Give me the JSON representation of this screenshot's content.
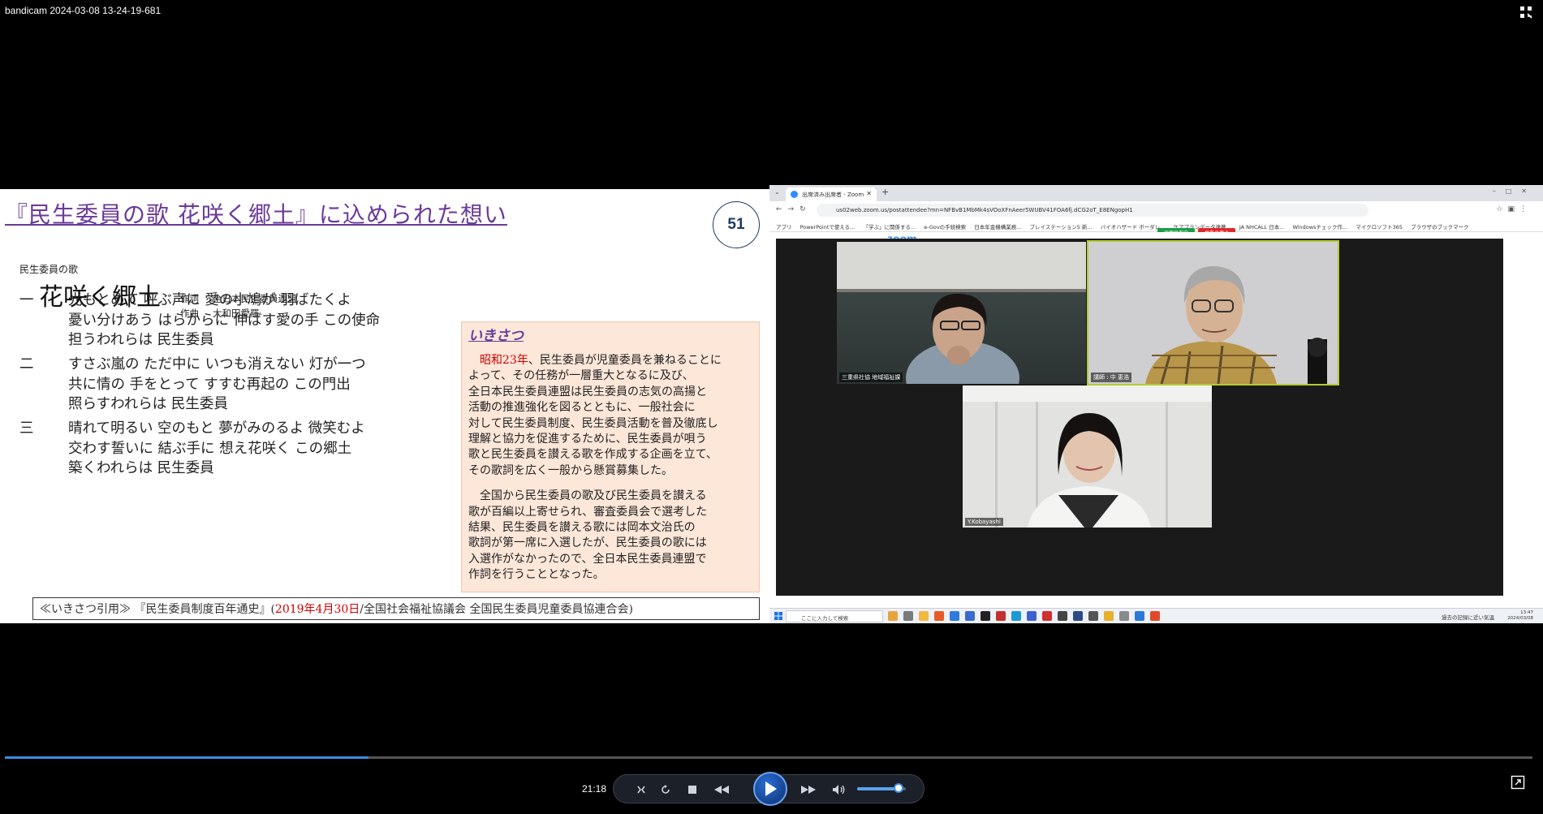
{
  "window": {
    "title": "bandicam 2024-03-08 13-24-19-681",
    "fullscreen_icon": "fullscreen-icon"
  },
  "slide": {
    "title": "『民生委員の歌 花咲く郷土』に込められた想い",
    "page_number": "51",
    "song_subtitle": "民生委員の歌",
    "song_name": "花咲く郷土",
    "credits": [
      {
        "label": "作詞",
        "value": "全日本民生委員連盟"
      },
      {
        "label": "作曲",
        "value": "大和田愛羅"
      }
    ],
    "verses": [
      {
        "num": "一",
        "lines": [
          "光もとめて 呼ぶ声に 愛の小鳩が 羽ばたくよ",
          "憂い分けあう はらからに 伸ばす愛の手 この使命",
          "担うわれらは 民生委員"
        ]
      },
      {
        "num": "二",
        "lines": [
          "すさぶ嵐の ただ中に いつも消えない 灯が一つ",
          "共に情の 手をとって すすむ再起の この門出",
          "照らすわれらは 民生委員"
        ]
      },
      {
        "num": "三",
        "lines": [
          "晴れて明るい 空のもと 夢がみのるよ 微笑むよ",
          "交わす誓いに 結ぶ手に 想え花咲く この郷土",
          "築くわれらは 民生委員"
        ]
      }
    ],
    "story": {
      "heading": "いきさつ",
      "para1_highlight": "昭和23年",
      "para1_lines": [
        "、民生委員が児童委員を兼ねることに",
        "よって、その任務が一層重大となるに及び、",
        "全日本民生委員連盟は民生委員の志気の高揚と",
        "活動の推進強化を図るとともに、一般社会に",
        "対して民生委員制度、民生委員活動を普及徹底し",
        "理解と協力を促進するために、民生委員が唄う",
        "歌と民生委員を讃える歌を作成する企画を立て、",
        "その歌詞を広く一般から懸賞募集した。"
      ],
      "para2_lines": [
        "全国から民生委員の歌及び民生委員を讃える",
        "歌が百編以上寄せられ、審査委員会で選考した",
        "結果、民生委員を讃える歌には岡本文治氏の",
        "歌詞が第一席に入選したが、民生委員の歌には",
        "入選作がなかったので、全日本民生委員連盟で",
        "作詞を行うこととなった。"
      ]
    },
    "citation": {
      "prefix": "≪いきさつ引用≫ 『民生委員制度百年通史』(",
      "date": "2019年4月30日",
      "suffix": "/全国社会福祉協議会 全国民生委員児童委員協連合会)"
    }
  },
  "browser": {
    "tab_title": "出席済み出席者 - Zoom",
    "url": "us02web.zoom.us/postattendee?mn=NFBvB1MbMk4sVOoXFnAeer5WUBV41FOA6fj.dCG2oT_E8ENgopH1",
    "bookmarks": [
      "アプリ",
      "PowerPointで使える...",
      "「学ぶ」に関係する...",
      "e-Govの手続検索",
      "日本年金機構業務...",
      "ブレイステーション5 新...",
      "バイオハザード ボーダレ...",
      "ケアプランデータ連携...",
      "JA NHCALL 日本...",
      "Windowsチェック作...",
      "マイクロソフト365",
      "ブラウザのブックマーク"
    ],
    "share_buttons": {
      "green": "画面共有中",
      "red": "共有の停止"
    },
    "zoom_logo": "zoom",
    "participants": [
      {
        "name": "三重県社協 地域福祉課"
      },
      {
        "name": "講師 : 中 恵浩"
      },
      {
        "name": "Y.Kobayashi"
      }
    ],
    "taskbar": {
      "search_placeholder": "ここに入力して検索",
      "tray_text": "過去の記録に近い気温",
      "time": "13:47",
      "date": "2024/03/08"
    }
  },
  "player": {
    "elapsed": "21:18",
    "progress": 0.238,
    "volume": 0.85,
    "accent": "#3a8de0"
  }
}
